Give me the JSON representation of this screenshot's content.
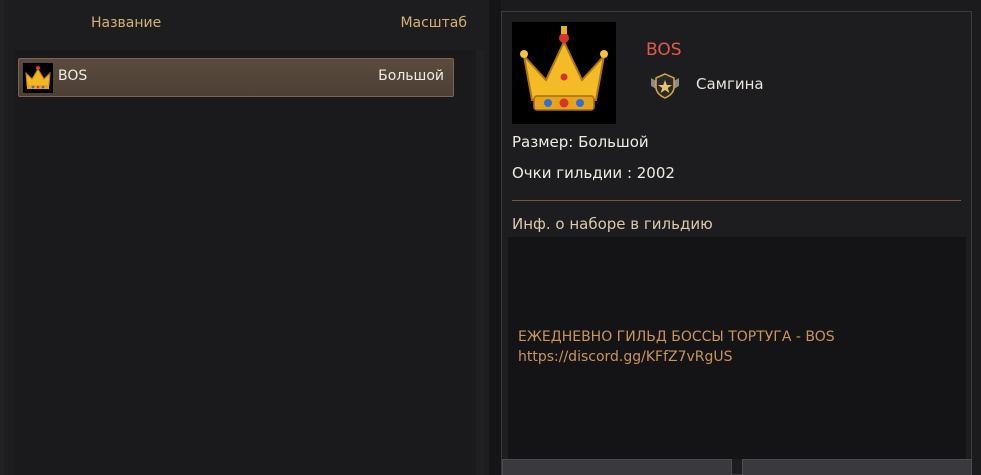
{
  "list": {
    "header_name": "Название",
    "header_scale": "Масштаб",
    "rows": [
      {
        "name": "BOS",
        "scale": "Большой",
        "emblem": "crown-icon"
      }
    ]
  },
  "details": {
    "guild_name": "BOS",
    "rank_icon": "master-rank-icon",
    "leader": "Самгина",
    "size_line": "Размер: Большой",
    "points_line": "Очки гильдии : 2002",
    "recruit_title": "Инф. о наборе в гильдию",
    "recruit_text": "ЕЖЕДНЕВНО ГИЛЬД БОССЫ ТОРТУГА - BOS\nhttps://discord.gg/KFfZ7vRgUS"
  },
  "colors": {
    "accent_gold": "#d6b071",
    "guild_name_red": "#e35a4a",
    "selected_row": "#54463a"
  }
}
